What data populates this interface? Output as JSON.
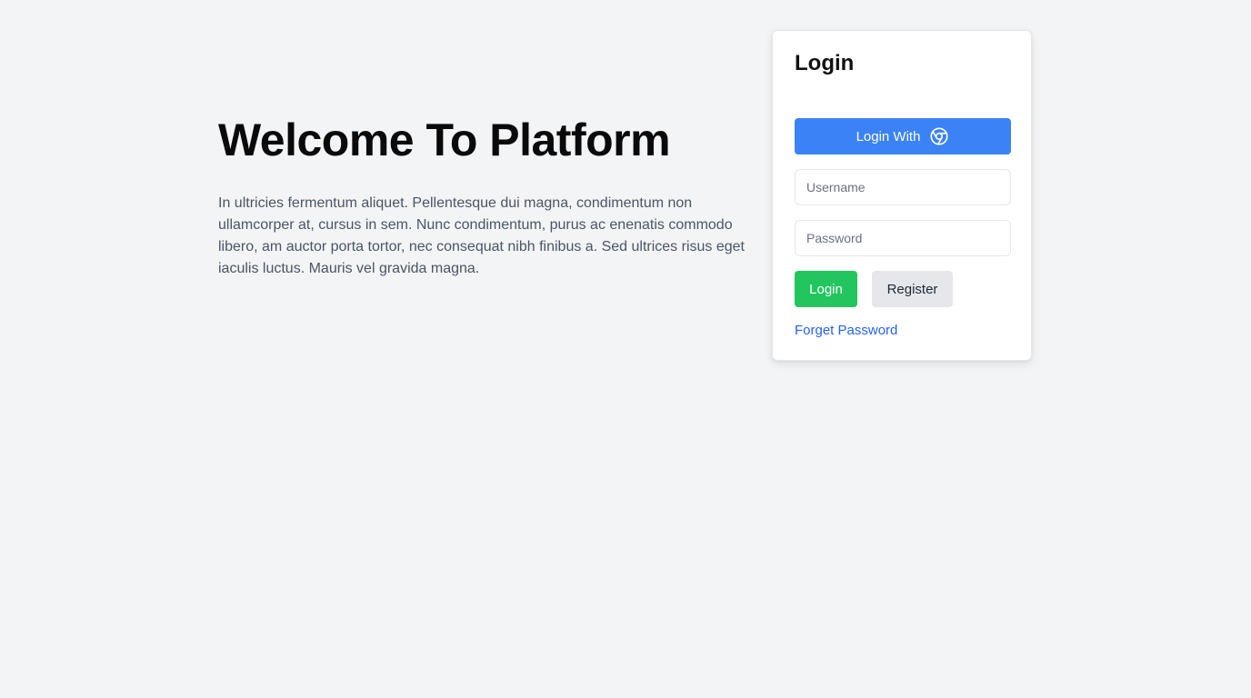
{
  "hero": {
    "title": "Welcome To Platform",
    "description": "In ultricies fermentum aliquet. Pellentesque dui magna, condimentum non ullamcorper at, cursus in sem. Nunc condimentum, purus ac enenatis commodo libero, am auctor porta tortor, nec consequat nibh finibus a. Sed ultrices risus eget iaculis luctus. Mauris vel gravida magna."
  },
  "login": {
    "title": "Login",
    "oauth_label": "Login With",
    "oauth_icon": "chrome-icon",
    "username_placeholder": "Username",
    "password_placeholder": "Password",
    "login_label": "Login",
    "register_label": "Register",
    "forgot_label": "Forget Password"
  },
  "colors": {
    "background": "#f3f4f6",
    "oauth": "#3b82f6",
    "login": "#22c55e",
    "register": "#e5e7eb",
    "link": "#2563eb"
  }
}
